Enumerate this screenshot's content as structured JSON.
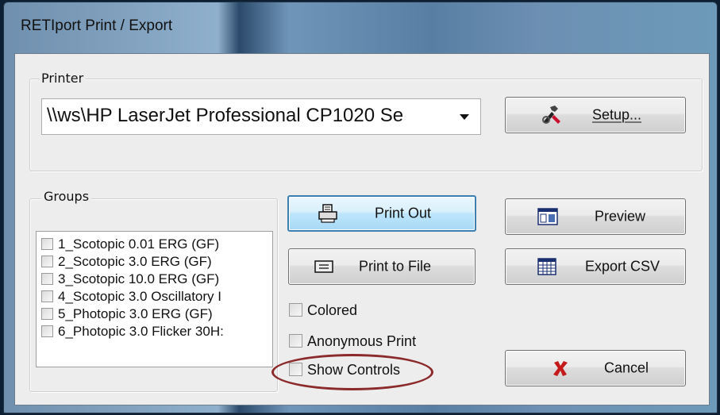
{
  "window": {
    "title": "RETIport Print / Export"
  },
  "printer": {
    "group_label": "Printer",
    "selected": "\\\\ws\\HP LaserJet Professional CP1020 Se",
    "setup_label": "Setup..."
  },
  "groups": {
    "label": "Groups",
    "items": [
      "1_Scotopic 0.01 ERG (GF)",
      "2_Scotopic 3.0 ERG (GF)",
      "3_Scotopic 10.0 ERG (GF)",
      "4_Scotopic 3.0 Oscillatory I",
      "5_Photopic 3.0 ERG (GF)",
      "6_Photopic 3.0 Flicker 30H:"
    ]
  },
  "actions": {
    "print_out": "Print Out",
    "print_to_file": "Print to File",
    "preview": "Preview",
    "export_csv": "Export CSV",
    "cancel": "Cancel"
  },
  "options": {
    "colored": "Colored",
    "anonymous_print": "Anonymous Print",
    "show_controls": "Show Controls"
  },
  "colors": {
    "annotation": "#8b2a2a",
    "cancel_icon": "#c41a1a",
    "focus_border": "#3c7fb1"
  }
}
